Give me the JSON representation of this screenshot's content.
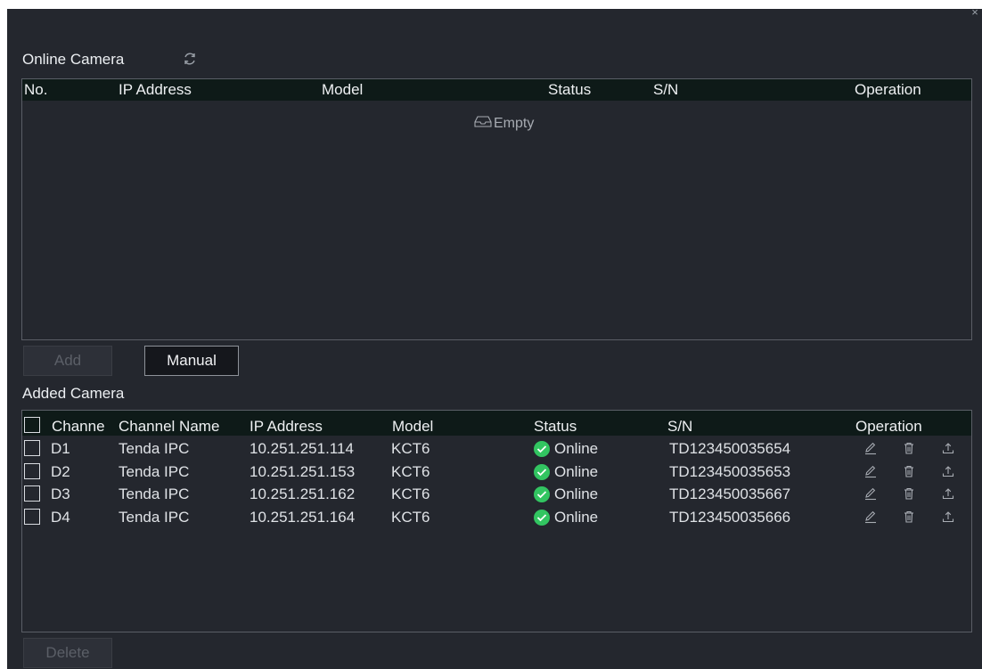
{
  "dialog": {
    "close_glyph": "×"
  },
  "online": {
    "title": "Online Camera",
    "refresh_icon": "refresh-icon",
    "columns": [
      "No.",
      "IP Address",
      "Model",
      "Status",
      "S/N",
      "Operation"
    ],
    "empty_text": "Empty",
    "empty_icon": "inbox-icon",
    "add_label": "Add",
    "manual_label": "Manual"
  },
  "added": {
    "title": "Added Camera",
    "columns": [
      "Channe",
      "Channel Name",
      "IP Address",
      "Model",
      "Status",
      "S/N",
      "Operation"
    ],
    "rows": [
      {
        "channel": "D1",
        "name": "Tenda IPC",
        "ip": "10.251.251.114",
        "model": "KCT6",
        "status": "Online",
        "sn": "TD123450035654"
      },
      {
        "channel": "D2",
        "name": "Tenda IPC",
        "ip": "10.251.251.153",
        "model": "KCT6",
        "status": "Online",
        "sn": "TD123450035653"
      },
      {
        "channel": "D3",
        "name": "Tenda IPC",
        "ip": "10.251.251.162",
        "model": "KCT6",
        "status": "Online",
        "sn": "TD123450035667"
      },
      {
        "channel": "D4",
        "name": "Tenda IPC",
        "ip": "10.251.251.164",
        "model": "KCT6",
        "status": "Online",
        "sn": "TD123450035666"
      }
    ],
    "operation_icons": [
      "edit-icon",
      "delete-icon",
      "upload-icon"
    ],
    "delete_label": "Delete"
  },
  "colors": {
    "panel": "#24272e",
    "header": "#0e1a18",
    "online_green": "#32c561"
  }
}
